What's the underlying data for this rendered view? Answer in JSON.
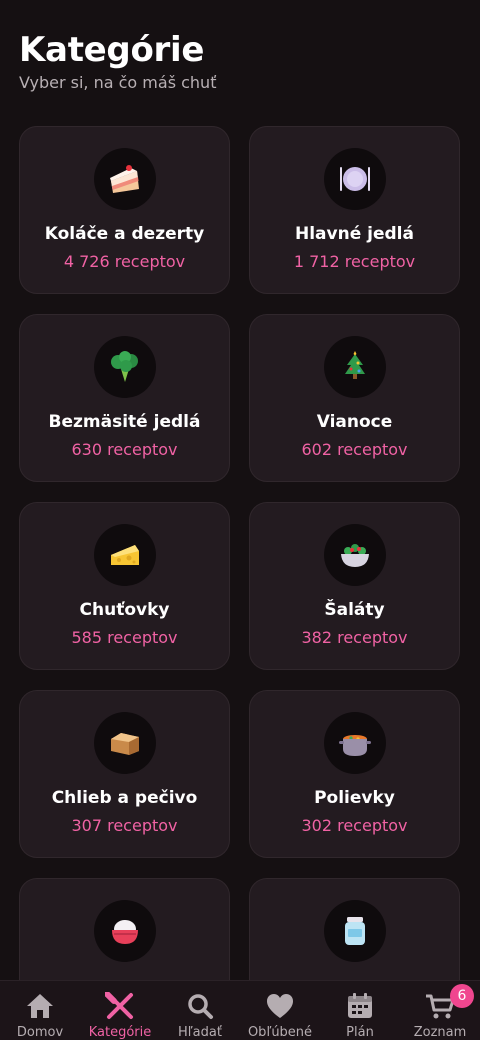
{
  "header": {
    "title": "Kategórie",
    "subtitle": "Vyber si, na čo máš chuť"
  },
  "categories": [
    {
      "name": "Koláče a dezerty",
      "count": "4 726 receptov",
      "icon": "cake-icon"
    },
    {
      "name": "Hlavné jedlá",
      "count": "1 712 receptov",
      "icon": "plate-icon"
    },
    {
      "name": "Bezmäsité jedlá",
      "count": "630 receptov",
      "icon": "broccoli-icon"
    },
    {
      "name": "Vianoce",
      "count": "602 receptov",
      "icon": "christmas-tree-icon"
    },
    {
      "name": "Chuťovky",
      "count": "585 receptov",
      "icon": "cheese-icon"
    },
    {
      "name": "Šaláty",
      "count": "382 receptov",
      "icon": "salad-icon"
    },
    {
      "name": "Chlieb a pečivo",
      "count": "307 receptov",
      "icon": "bread-icon"
    },
    {
      "name": "Polievky",
      "count": "302 receptov",
      "icon": "soup-icon"
    },
    {
      "name": "",
      "count": "",
      "icon": "rice-bowl-icon"
    },
    {
      "name": "",
      "count": "",
      "icon": "jar-icon"
    }
  ],
  "nav": {
    "items": [
      {
        "label": "Domov",
        "icon": "home-icon"
      },
      {
        "label": "Kategórie",
        "icon": "utensils-icon",
        "active": true
      },
      {
        "label": "Hľadať",
        "icon": "search-icon"
      },
      {
        "label": "Obľúbené",
        "icon": "heart-icon"
      },
      {
        "label": "Plán",
        "icon": "calendar-icon"
      },
      {
        "label": "Zoznam",
        "icon": "cart-icon",
        "badge": "6"
      }
    ]
  },
  "colors": {
    "background": "#151012",
    "card": "#231b20",
    "accent": "#f062a4",
    "badge": "#f0468f"
  }
}
